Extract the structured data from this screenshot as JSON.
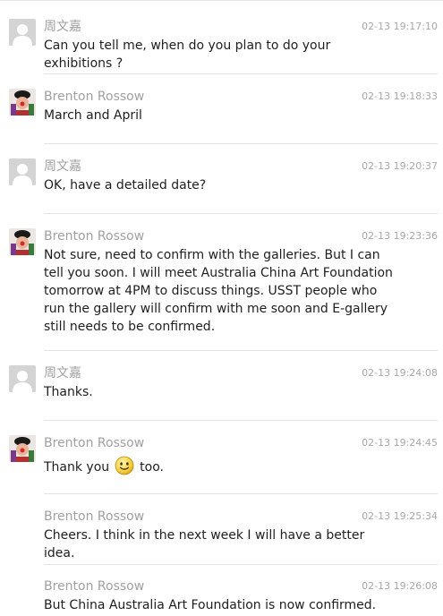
{
  "messages": [
    {
      "sender": "周文嘉",
      "time": "02-13 19:17:10",
      "avatar": "default-avatar-icon",
      "text": "Can you tell me, when do you plan to do your exhibitions ?"
    },
    {
      "sender": "Brenton Rossow",
      "time": "02-13 19:18:33",
      "avatar": "user-photo",
      "text": "March and April"
    },
    {
      "sender": "周文嘉",
      "time": "02-13 19:20:37",
      "avatar": "default-avatar-icon",
      "text": "OK, have a detailed date?"
    },
    {
      "sender": "Brenton Rossow",
      "time": "02-13 19:23:36",
      "avatar": "user-photo",
      "text": "Not sure, need to confirm with the galleries. But I can tell you soon. I will meet Australia China Art Foundation tomorrow at 4PM to discuss things. USST people who run the gallery will confirm with me soon and E-gallery still needs to be confirmed."
    },
    {
      "sender": "周文嘉",
      "time": "02-13 19:24:08",
      "avatar": "default-avatar-icon",
      "text": "Thanks."
    },
    {
      "sender": "Brenton Rossow",
      "time": "02-13 19:24:45",
      "avatar": "user-photo",
      "text_before": "Thank you",
      "emoji": "smiley-emoji-icon",
      "text_after": "too."
    },
    {
      "sender": "Brenton Rossow",
      "time": "02-13 19:25:34",
      "text": "Cheers. I think in the next week I will have a better idea."
    },
    {
      "sender": "Brenton Rossow",
      "time": "02-13 19:26:08",
      "text": "But China Australia Art Foundation is now confirmed."
    }
  ]
}
